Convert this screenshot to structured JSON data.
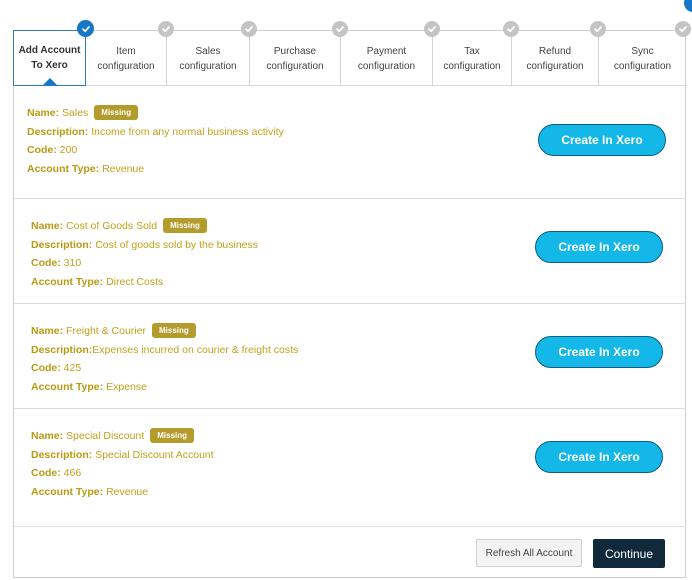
{
  "steps": [
    {
      "label_line1": "Add Account",
      "label_line2": "To Xero",
      "state": "active",
      "icon": "check-circle-icon"
    },
    {
      "label_line1": "Item",
      "label_line2": "configuration",
      "state": "pending",
      "icon": "check-circle-icon"
    },
    {
      "label_line1": "Sales",
      "label_line2": "configuration",
      "state": "pending",
      "icon": "check-circle-icon"
    },
    {
      "label_line1": "Purchase",
      "label_line2": "configuration",
      "state": "pending",
      "icon": "check-circle-icon"
    },
    {
      "label_line1": "Payment",
      "label_line2": "configuration",
      "state": "pending",
      "icon": "check-circle-icon"
    },
    {
      "label_line1": "Tax",
      "label_line2": "configuration",
      "state": "pending",
      "icon": "check-circle-icon"
    },
    {
      "label_line1": "Refund",
      "label_line2": "configuration",
      "state": "pending",
      "icon": "check-circle-icon"
    },
    {
      "label_line1": "Sync",
      "label_line2": "configuration",
      "state": "pending",
      "icon": "check-circle-icon"
    }
  ],
  "labels": {
    "name": "Name:",
    "description": "Description:",
    "code": "Code:",
    "account_type": "Account Type:"
  },
  "accounts": [
    {
      "name": "Sales",
      "status": "Missing",
      "description": "Income from any normal business activity",
      "code": "200",
      "account_type": "Revenue",
      "action": "Create In Xero"
    },
    {
      "name": "Cost of Goods Sold",
      "status": "Missing",
      "description": "Cost of goods sold by the business",
      "code": "310",
      "account_type": "Direct Costs",
      "action": "Create In Xero"
    },
    {
      "name": "Freight & Courier",
      "status": "Missing",
      "description": "Expenses incurred on courier & freight costs",
      "code": "425",
      "account_type": "Expense",
      "action": "Create In Xero"
    },
    {
      "name": "Special Discount",
      "status": "Missing",
      "description": "Special Discount Account",
      "code": "466",
      "account_type": "Revenue",
      "action": "Create In Xero"
    }
  ],
  "footer": {
    "refresh_label": "Refresh All Account",
    "continue_label": "Continue"
  },
  "colors": {
    "active_step": "#1677c9",
    "pending_step": "#c4c4c4",
    "field_text": "#c0a21a",
    "missing_badge": "#b39b2c",
    "create_button": "#14b8e8",
    "continue_button": "#102a3c"
  }
}
